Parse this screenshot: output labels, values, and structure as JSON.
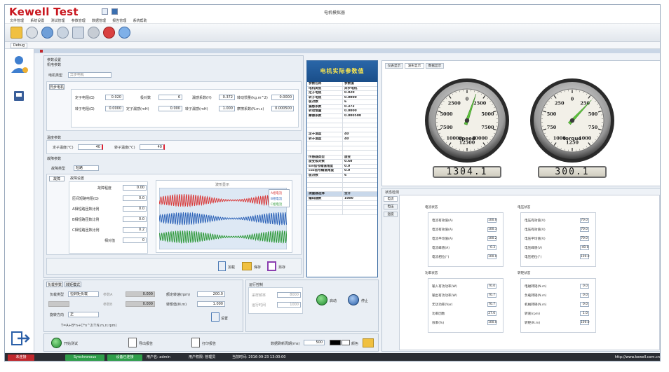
{
  "app": {
    "logo": "Kewell Test",
    "window_title": "电机模拟器",
    "menus": [
      "文件管理",
      "系统设置",
      "测试管理",
      "参数管理",
      "数据管理",
      "报告管理",
      "系统帮助"
    ],
    "tab": "Debug"
  },
  "left_panel": {
    "section_title": "参数设置",
    "subsection": "机电参数",
    "motor_type_label": "电机类型",
    "motor_type_value": "异步电机",
    "inner_tab": "异步电机",
    "fields": [
      {
        "label": "定子电阻(Ω)",
        "value": "0.020"
      },
      {
        "label": "极对数",
        "value": "6"
      },
      {
        "label": "漏感系数(H)",
        "value": "0.372"
      },
      {
        "label": "转动惯量(kg.m^2)",
        "value": "0.0000"
      },
      {
        "label": "转子电阻(Ω)",
        "value": "0.0000"
      },
      {
        "label": "定子漏感(mH)",
        "value": "0.000"
      },
      {
        "label": "转子漏感(mH)",
        "value": "1.000"
      },
      {
        "label": "摩擦系数(N.m.s)",
        "value": "0.000500"
      }
    ],
    "temp_section": "温度参数",
    "temp_fields": [
      {
        "label": "定子温度(℃)",
        "value": "40"
      },
      {
        "label": "转子温度(℃)",
        "value": "40"
      }
    ],
    "fault_section": "故障参数",
    "fault_type_label": "故障类型",
    "fault_type_value": "短路",
    "fault_tab": "故障",
    "fault_sub": "故障设置",
    "fault_fields": [
      {
        "label": "故障程度",
        "value": "0.00"
      },
      {
        "label": "匝间短路电阻(Ω)",
        "value": "0.0"
      },
      {
        "label": "A相短路匝数比例",
        "value": "0.0"
      },
      {
        "label": "B相短路匝数比例",
        "value": "0.0"
      },
      {
        "label": "C相短路匝数比例",
        "value": "0.2"
      },
      {
        "label": "相对值",
        "value": "0"
      }
    ],
    "plot_title": "波形显示",
    "legend": [
      "A相电流",
      "B相电流",
      "C相电流"
    ],
    "buttons": [
      "加载",
      "保存",
      "另存"
    ]
  },
  "bottom_left": {
    "tabs": [
      "负载参数",
      "转矩模式"
    ],
    "load_type_label": "负载类型",
    "load_type_value": "恒转矩负载",
    "rows": [
      {
        "label": "参数A",
        "value": "0.000"
      },
      {
        "label": "参数B",
        "value": "0.000"
      },
      {
        "label": "额定转速(rpm)",
        "value": "200.0"
      },
      {
        "label": "转矩值(N.m)",
        "value": "1.000"
      }
    ],
    "dir_label": "旋转方向",
    "dir_value": "正",
    "formula": "T=A+B*n+C*n^2(T:N.m,n:rpm)",
    "set_button": "设置"
  },
  "run_panel": {
    "title": "运行控制",
    "rows": [
      {
        "label": "采样频率",
        "value": "8000"
      },
      {
        "label": "运行时间",
        "value": "1000"
      }
    ],
    "start_label": "启动",
    "stop_label": "停止"
  },
  "param_table": {
    "title": "电机实际参数值",
    "rows": [
      [
        "参数名称",
        "参数值"
      ],
      [
        "电机类型",
        "异步电机"
      ],
      [
        "定子电阻",
        "0.020"
      ],
      [
        "转子电阻",
        "0.0000"
      ],
      [
        "极对数",
        "6"
      ],
      [
        "漏感系数",
        "0.372"
      ],
      [
        "转动惯量",
        "0.0000"
      ],
      [
        "摩擦系数",
        "0.000500"
      ],
      [
        "",
        ""
      ],
      [
        "",
        ""
      ],
      [
        "",
        ""
      ],
      [
        "定子温度",
        "40"
      ],
      [
        "转子温度",
        "40"
      ],
      [
        "",
        ""
      ],
      [
        "",
        ""
      ],
      [
        "",
        ""
      ],
      [
        "传感器类型",
        "旋变"
      ],
      [
        "旋变极对数",
        "0.60"
      ],
      [
        "sin信号幅值角度",
        "0.0"
      ],
      [
        "cos信号幅值角度",
        "0.0"
      ],
      [
        "极对数",
        "6"
      ],
      [
        "",
        ""
      ],
      [
        "",
        ""
      ],
      [
        "",
        ""
      ],
      [
        "测量器选择",
        "全开"
      ],
      [
        "编码器数",
        "1000"
      ],
      [
        "",
        ""
      ],
      [
        "",
        ""
      ],
      [
        "",
        ""
      ]
    ]
  },
  "gauge_panel": {
    "tabs": [
      "仪表显示",
      "波形显示",
      "数据显示"
    ],
    "active_tab": 1,
    "gauges": [
      {
        "name": "speed",
        "value": 1304.1,
        "display": "1304.1",
        "max": 12500,
        "ticks": [
          "0",
          "2500",
          "5000",
          "7500",
          "10000",
          "12500",
          "10000",
          "7500",
          "5000",
          "2500"
        ]
      },
      {
        "name": "torque",
        "value": 300.1,
        "display": "300.1",
        "max": 1250,
        "ticks": [
          "0",
          "250",
          "500",
          "750",
          "1000",
          "1250",
          "1000",
          "750",
          "500",
          "250"
        ]
      }
    ]
  },
  "detect_panel": {
    "title": "状态检测",
    "side_tabs": [
      "电流",
      "电压",
      "温度"
    ],
    "groups": [
      {
        "title": "电流状态",
        "rows": [
          [
            "电流有效值(A)",
            "100.0"
          ],
          [
            "电流有效值(A)",
            "100.3"
          ],
          [
            "电流平均值(A)",
            "100.2"
          ],
          [
            "电流峰值(A)",
            "-0.3"
          ],
          [
            "电流相位(°)",
            "100.0"
          ]
        ]
      },
      {
        "title": "电压状态",
        "rows": [
          [
            "电压有效值(V)",
            "70.0"
          ],
          [
            "电压有效值(V)",
            "70.0"
          ],
          [
            "电压平均值(V)",
            "70.0"
          ],
          [
            "电压峰值(V)",
            "-40.0"
          ],
          [
            "电压相位(°)",
            "100.0"
          ]
        ]
      },
      {
        "title": "功率状态",
        "rows": [
          [
            "输入有功功率(W)",
            "70.0"
          ],
          [
            "输出有功功率(W)",
            "70.7"
          ],
          [
            "无功功率(Var)",
            "70.7"
          ],
          [
            "功率因数",
            "27.6"
          ],
          [
            "效率(%)",
            "100.0"
          ]
        ]
      },
      {
        "title": "转矩状态",
        "rows": [
          [
            "电磁转矩(N.m)",
            "0.0"
          ],
          [
            "负载转矩(N.m)",
            "0.0"
          ],
          [
            "机械转矩(N.m)",
            "0.0"
          ],
          [
            "转速(rpm)",
            "1.0"
          ],
          [
            "转矩(N.m)",
            "100.0"
          ]
        ]
      }
    ]
  },
  "bottom_bar": {
    "buttons": [
      "开始测试",
      "导出报告",
      "打印报告"
    ],
    "refresh_label": "数据刷新周期(ms)",
    "refresh_value": "500",
    "color_label": "颜色"
  },
  "statusbar": {
    "segments": [
      "未连接",
      "Synchronous",
      "设备已连接"
    ],
    "user_label": "用户名: admin",
    "role_label": "用户权限: 管理员",
    "time_label": "当前时间: 2016-09-23 13:00:00",
    "url": "http://www.kewell.com.cn"
  },
  "colors": {
    "brand_red": "#c8161e",
    "title_blue": "#1f5a99",
    "title_text": "#ffe94d",
    "wave_red": "#d93a3a",
    "wave_blue": "#2d63b8",
    "wave_green": "#2f9a3a",
    "status_red": "#c0282d",
    "status_green": "#2f9e4a"
  }
}
